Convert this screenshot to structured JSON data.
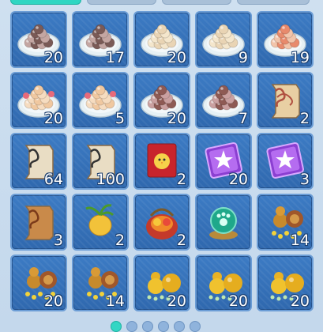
{
  "inventory": {
    "items": [
      {
        "icon": "dark-rice-balls-plate-icon",
        "count": "20"
      },
      {
        "icon": "dark-rice-balls-plate-icon",
        "count": "17"
      },
      {
        "icon": "sesame-rice-balls-plate-icon",
        "count": "20"
      },
      {
        "icon": "sesame-rice-balls-plate-icon",
        "count": "9"
      },
      {
        "icon": "red-rice-balls-plate-icon",
        "count": "19"
      },
      {
        "icon": "rose-rice-balls-plate-icon",
        "count": "20"
      },
      {
        "icon": "rose-rice-balls-plate-icon",
        "count": "5"
      },
      {
        "icon": "brown-rice-balls-plate-icon",
        "count": "20"
      },
      {
        "icon": "brown-rice-balls-plate-icon",
        "count": "7"
      },
      {
        "icon": "map-scroll-icon",
        "count": "2"
      },
      {
        "icon": "flame-scroll-icon",
        "count": "64"
      },
      {
        "icon": "flame-scroll-icon",
        "count": "100"
      },
      {
        "icon": "chick-red-scroll-icon",
        "count": "2"
      },
      {
        "icon": "purple-star-ticket-icon",
        "count": "20"
      },
      {
        "icon": "purple-star-ticket-icon",
        "count": "3"
      },
      {
        "icon": "fire-rune-scroll-icon",
        "count": "3"
      },
      {
        "icon": "golden-turnip-icon",
        "count": "2"
      },
      {
        "icon": "fruit-basket-icon",
        "count": "2"
      },
      {
        "icon": "paw-crystal-orb-icon",
        "count": ""
      },
      {
        "icon": "gourd-coins-icon",
        "count": "14"
      },
      {
        "icon": "gourd-coins-icon",
        "count": "20"
      },
      {
        "icon": "gourd-coins-icon",
        "count": "14"
      },
      {
        "icon": "gold-gourd-pearls-icon",
        "count": "20"
      },
      {
        "icon": "gold-gourd-pearls-icon",
        "count": "20"
      },
      {
        "icon": "gold-gourd-pearls-icon",
        "count": "20"
      }
    ]
  },
  "pager": {
    "pages": 6,
    "current": 1
  }
}
